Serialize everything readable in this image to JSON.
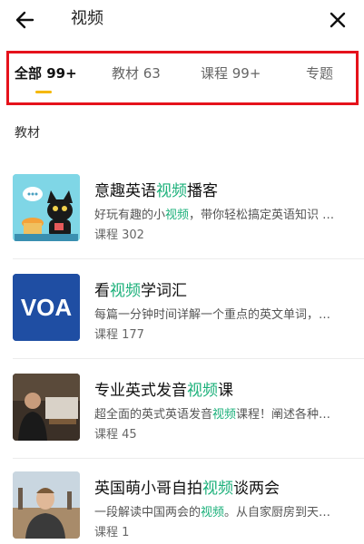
{
  "header": {
    "title": "视频"
  },
  "tabs": [
    {
      "label": "全部 99+",
      "active": true
    },
    {
      "label": "教材 63",
      "active": false
    },
    {
      "label": "课程 99+",
      "active": false
    },
    {
      "label": "专题",
      "active": false
    }
  ],
  "section": {
    "title": "教材"
  },
  "items": [
    {
      "title_pre": "意趣英语",
      "title_hl": "视频",
      "title_post": "播客",
      "desc_pre": "好玩有趣的小",
      "desc_hl": "视频",
      "desc_post": "，带你轻松搞定英语知识 …",
      "count": "课程 302"
    },
    {
      "title_pre": "看",
      "title_hl": "视频",
      "title_post": "学词汇",
      "desc_pre": "每篇一分钟时间详解一个重点的英文单词，…",
      "desc_hl": "",
      "desc_post": "",
      "count": "课程 177",
      "thumb_text": "VOA"
    },
    {
      "title_pre": "专业英式发音",
      "title_hl": "视频",
      "title_post": "课",
      "desc_pre": "超全面的英式英语发音",
      "desc_hl": "视频",
      "desc_post": "课程！阐述各种…",
      "count": "课程 45"
    },
    {
      "title_pre": "英国萌小哥自拍",
      "title_hl": "视频",
      "title_post": "谈两会",
      "desc_pre": "一段解读中国两会的",
      "desc_hl": "视频",
      "desc_post": "。从自家厨房到天…",
      "count": "课程 1"
    }
  ],
  "colors": {
    "highlight": "#1bb07a",
    "tab_indicator": "#f5b800",
    "annotation_box": "#e5121b"
  }
}
